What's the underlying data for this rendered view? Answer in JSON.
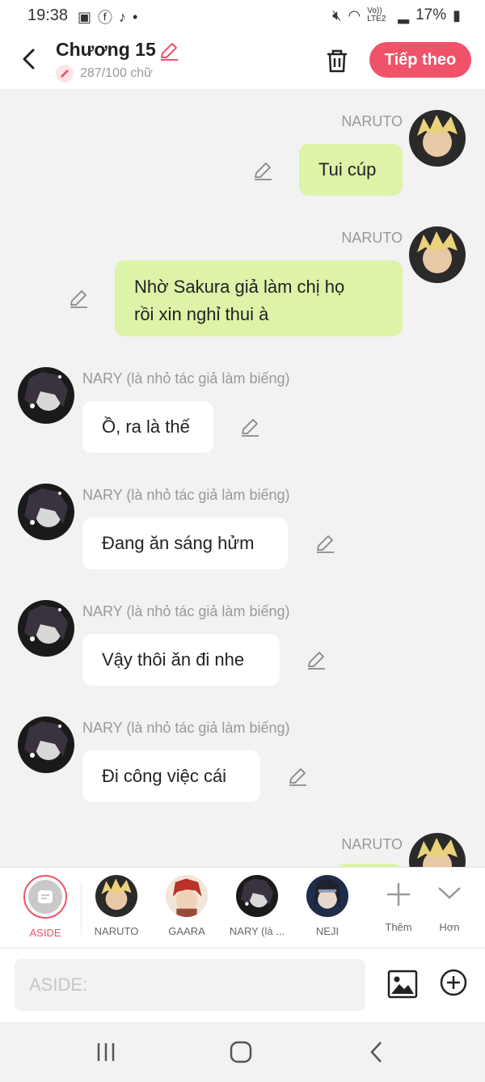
{
  "status_bar": {
    "time": "19:38",
    "battery": "17%",
    "network": "Vo)) LTE2"
  },
  "header": {
    "title": "Chương 15",
    "word_count": "287/100 chữ",
    "next_label": "Tiếp theo"
  },
  "messages": [
    {
      "side": "right",
      "name": "NARUTO",
      "lines": [
        "Tui cúp"
      ]
    },
    {
      "side": "right",
      "name": "NARUTO",
      "lines": [
        "Nhờ Sakura giả làm chị họ",
        "rồi xin nghỉ thui à"
      ]
    },
    {
      "side": "left",
      "name": "NARY (là nhỏ tác giả làm biếng)",
      "lines": [
        "Ồ, ra là thế"
      ]
    },
    {
      "side": "left",
      "name": "NARY (là nhỏ tác giả làm biếng)",
      "lines": [
        "Đang ăn sáng hửm"
      ]
    },
    {
      "side": "left",
      "name": "NARY (là nhỏ tác giả làm biếng)",
      "lines": [
        "Vậy thôi ăn đi nhe"
      ]
    },
    {
      "side": "left",
      "name": "NARY (là nhỏ tác giả làm biếng)",
      "lines": [
        "Đi công việc cái"
      ]
    },
    {
      "side": "right",
      "name": "NARUTO",
      "lines": [
        ""
      ]
    }
  ],
  "characters": [
    {
      "label": "ASIDE",
      "selected": true
    },
    {
      "label": "NARUTO"
    },
    {
      "label": "GAARA"
    },
    {
      "label": "NARY (là ..."
    },
    {
      "label": "NEJI"
    }
  ],
  "actions": {
    "add_label": "Thêm",
    "more_label": "Hơn"
  },
  "input": {
    "placeholder": "ASIDE:"
  },
  "colors": {
    "accent": "#ef5269",
    "bubble_right": "#dcf3a8",
    "bubble_left": "#ffffff"
  }
}
